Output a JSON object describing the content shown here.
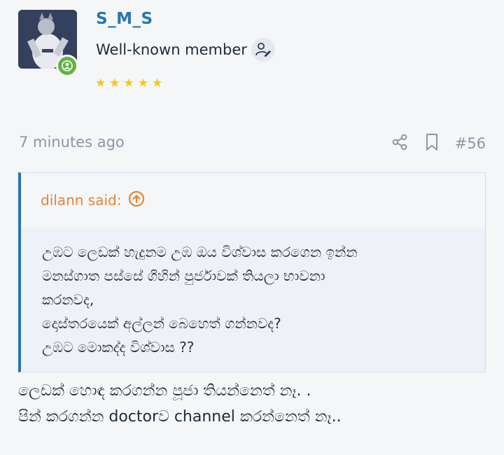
{
  "user": {
    "username": "S_M_S",
    "title": "Well-known member",
    "rating_stars": 5
  },
  "post": {
    "timestamp": "7 minutes ago",
    "number": "#56"
  },
  "quote": {
    "author_line": "dilann said:",
    "lines": [
      "උඹට ලෙඩක් හැදුනම උඹ ඔය විශ්වාස කරගෙන ඉන්න",
      "මනස්ගාත පස්සේ ගිහින් පුර්ජාවක් තියලා භාවනා",
      "කරනවද,",
      "දොස්තරයෙක් අල්ලන් බෙහෙත් ගන්නවද?",
      "උඹට මොකද්ද විශ්වාස ??"
    ]
  },
  "reply": {
    "lines": [
      "ලෙඩක් හොඳ කරගන්න පූජා තියන්නෙත් නෑ. .",
      "පින් කරගන්න doctorව channel කරන්නෙත් නෑ.."
    ]
  },
  "colors": {
    "accent": "#2577b1",
    "quote_author": "#e28537",
    "online": "#63b246",
    "star": "#f5c518",
    "muted": "#8c96a6"
  },
  "icons": {
    "online": "user-online-icon",
    "title_badge": "user-edit-icon",
    "share": "share-icon",
    "bookmark": "bookmark-icon",
    "quote_jump": "arrow-up-circle-icon",
    "star": "star-icon"
  }
}
